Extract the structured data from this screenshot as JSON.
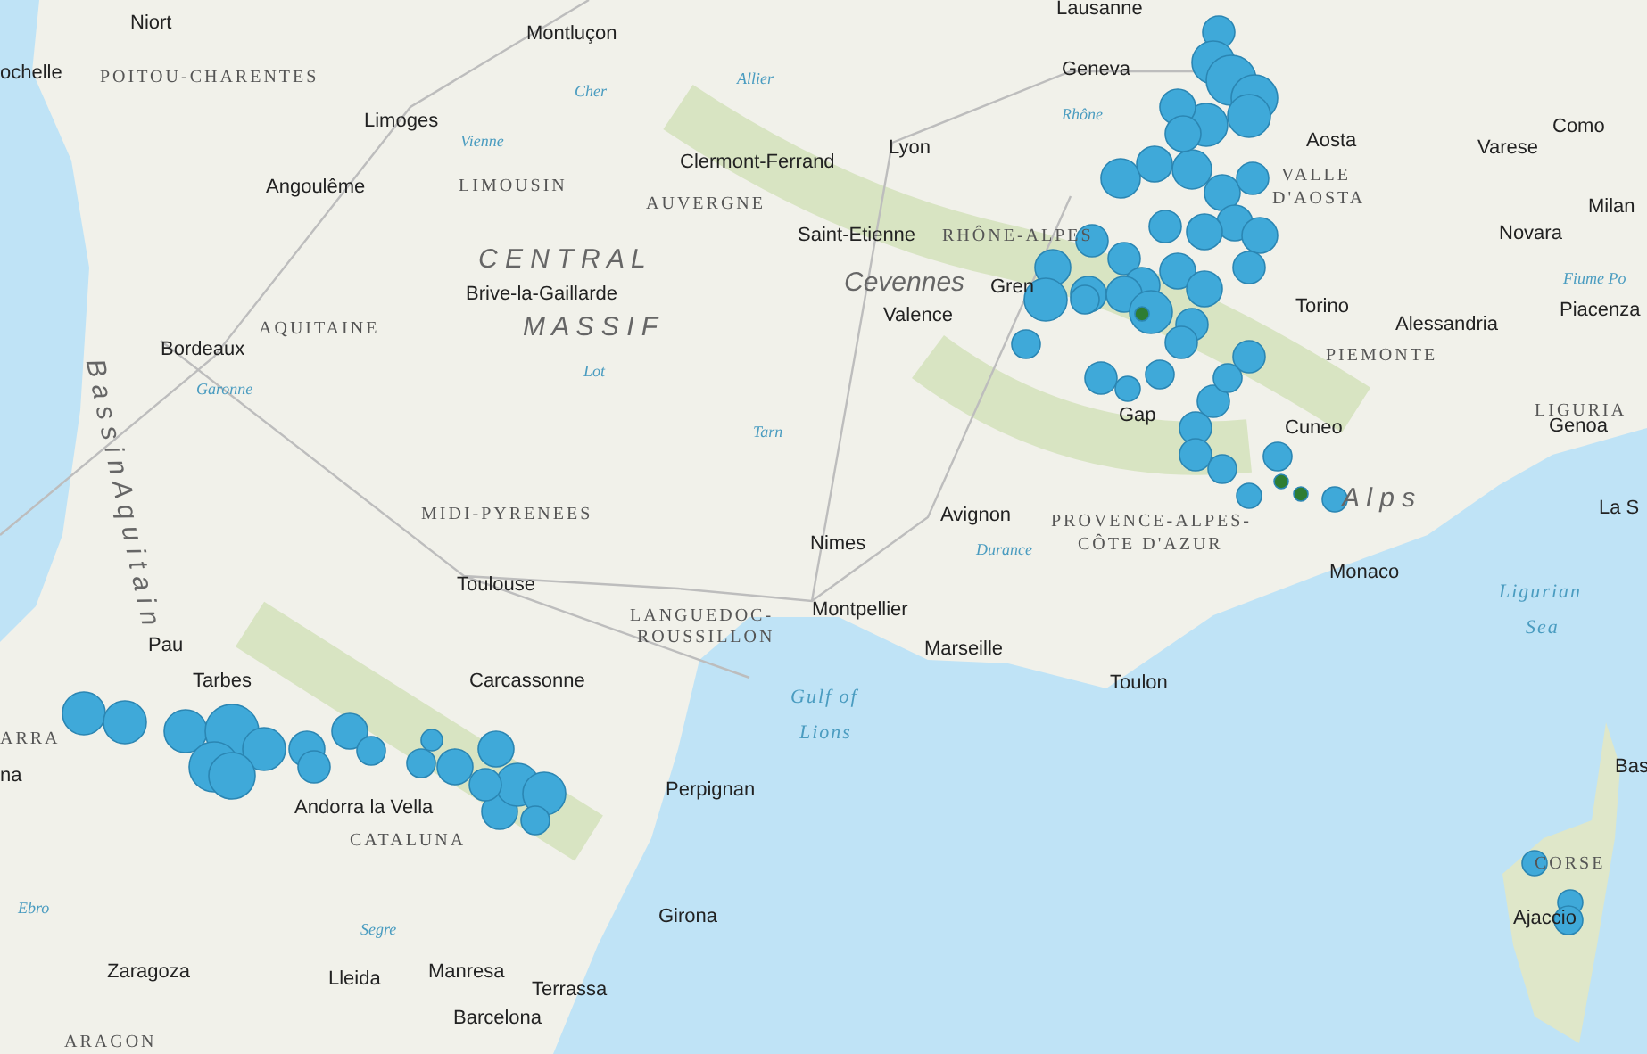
{
  "map": {
    "labels": [
      {
        "text": "Niort",
        "kind": "city"
      },
      {
        "text": "Montluçon",
        "kind": "city"
      },
      {
        "text": "ochelle",
        "kind": "city"
      },
      {
        "text": "POITOU-CHARENTES",
        "kind": "region"
      },
      {
        "text": "Limoges",
        "kind": "city"
      },
      {
        "text": "Vienne",
        "kind": "water"
      },
      {
        "text": "Cher",
        "kind": "water"
      },
      {
        "text": "Allier",
        "kind": "water"
      },
      {
        "text": "Clermont-Ferrand",
        "kind": "city"
      },
      {
        "text": "Angoulême",
        "kind": "city"
      },
      {
        "text": "LIMOUSIN",
        "kind": "region"
      },
      {
        "text": "AUVERGNE",
        "kind": "region"
      },
      {
        "text": "Lausanne",
        "kind": "city"
      },
      {
        "text": "Geneva",
        "kind": "city"
      },
      {
        "text": "Lyon",
        "kind": "city"
      },
      {
        "text": "Rhône",
        "kind": "water"
      },
      {
        "text": "Aosta",
        "kind": "city"
      },
      {
        "text": "VALLE",
        "kind": "region"
      },
      {
        "text": "D'AOSTA",
        "kind": "region"
      },
      {
        "text": "Como",
        "kind": "city"
      },
      {
        "text": "Varese",
        "kind": "city"
      },
      {
        "text": "Milan",
        "kind": "city"
      },
      {
        "text": "Saint-Etienne",
        "kind": "city"
      },
      {
        "text": "RHÔNE-ALPES",
        "kind": "region"
      },
      {
        "text": "Novara",
        "kind": "city"
      },
      {
        "text": "C E N T R A L",
        "kind": "mountain"
      },
      {
        "text": "Brive-la-Gaillarde",
        "kind": "city"
      },
      {
        "text": "Cevennes",
        "kind": "mountain"
      },
      {
        "text": "Gren",
        "kind": "city"
      },
      {
        "text": "Valence",
        "kind": "city"
      },
      {
        "text": "AQUITAINE",
        "kind": "region"
      },
      {
        "text": "M A S S I F",
        "kind": "mountain"
      },
      {
        "text": "Bordeaux",
        "kind": "city"
      },
      {
        "text": "Garonne",
        "kind": "water"
      },
      {
        "text": "Fiume Po",
        "kind": "water"
      },
      {
        "text": "Torino",
        "kind": "city"
      },
      {
        "text": "Alessandria",
        "kind": "city"
      },
      {
        "text": "Piacenza",
        "kind": "city"
      },
      {
        "text": "PIEMONTE",
        "kind": "region"
      },
      {
        "text": "Lot",
        "kind": "water"
      },
      {
        "text": "Tarn",
        "kind": "water"
      },
      {
        "text": "Gap",
        "kind": "city"
      },
      {
        "text": "Cuneo",
        "kind": "city"
      },
      {
        "text": "LIGURIA",
        "kind": "region"
      },
      {
        "text": "Genoa",
        "kind": "city"
      },
      {
        "text": "A l p s",
        "kind": "mountain"
      },
      {
        "text": "La S",
        "kind": "city"
      },
      {
        "text": "MIDI-PYRENEES",
        "kind": "region"
      },
      {
        "text": "Avignon",
        "kind": "city"
      },
      {
        "text": "PROVENCE-ALPES-",
        "kind": "region"
      },
      {
        "text": "Nimes",
        "kind": "city"
      },
      {
        "text": "Durance",
        "kind": "water"
      },
      {
        "text": "CÔTE D'AZUR",
        "kind": "region"
      },
      {
        "text": "Toulouse",
        "kind": "city"
      },
      {
        "text": "Monaco",
        "kind": "city"
      },
      {
        "text": "LANGUEDOC-",
        "kind": "region"
      },
      {
        "text": "Montpellier",
        "kind": "city"
      },
      {
        "text": "Ligurian",
        "kind": "sea"
      },
      {
        "text": "ROUSSILLON",
        "kind": "region"
      },
      {
        "text": "Sea",
        "kind": "sea"
      },
      {
        "text": "Pau",
        "kind": "city"
      },
      {
        "text": "Marseille",
        "kind": "city"
      },
      {
        "text": "Tarbes",
        "kind": "city"
      },
      {
        "text": "Carcassonne",
        "kind": "city"
      },
      {
        "text": "Toulon",
        "kind": "city"
      },
      {
        "text": "Gulf of",
        "kind": "sea"
      },
      {
        "text": "Lions",
        "kind": "sea"
      },
      {
        "text": "B a s s i n   A q u i t a i n",
        "kind": "mountain"
      },
      {
        "text": "ARRA",
        "kind": "region"
      },
      {
        "text": "na",
        "kind": "city"
      },
      {
        "text": "Bas",
        "kind": "city"
      },
      {
        "text": "Andorra la Vella",
        "kind": "city"
      },
      {
        "text": "Perpignan",
        "kind": "city"
      },
      {
        "text": "CATALUNA",
        "kind": "region"
      },
      {
        "text": "CORSE",
        "kind": "region"
      },
      {
        "text": "Ebro",
        "kind": "water"
      },
      {
        "text": "Segre",
        "kind": "water"
      },
      {
        "text": "Girona",
        "kind": "city"
      },
      {
        "text": "Ajaccio",
        "kind": "city"
      },
      {
        "text": "Zaragoza",
        "kind": "city"
      },
      {
        "text": "Lleida",
        "kind": "city"
      },
      {
        "text": "Manresa",
        "kind": "city"
      },
      {
        "text": "Terrassa",
        "kind": "city"
      },
      {
        "text": "Barcelona",
        "kind": "city"
      },
      {
        "text": "ARAGON",
        "kind": "region"
      }
    ],
    "markers": [
      {
        "color": "#3fa9d9"
      },
      {
        "color": "#3fa9d9"
      },
      {
        "color": "#3fa9d9"
      },
      {
        "color": "#3fa9d9"
      },
      {
        "color": "#3fa9d9"
      },
      {
        "color": "#3fa9d9"
      },
      {
        "color": "#3fa9d9"
      },
      {
        "color": "#3fa9d9"
      },
      {
        "color": "#3fa9d9"
      },
      {
        "color": "#3fa9d9"
      },
      {
        "color": "#3fa9d9"
      },
      {
        "color": "#3fa9d9"
      },
      {
        "color": "#3fa9d9"
      },
      {
        "color": "#3fa9d9"
      },
      {
        "color": "#3fa9d9"
      },
      {
        "color": "#3fa9d9"
      },
      {
        "color": "#3fa9d9"
      },
      {
        "color": "#3fa9d9"
      },
      {
        "color": "#3fa9d9"
      },
      {
        "color": "#3fa9d9"
      },
      {
        "color": "#3fa9d9"
      },
      {
        "color": "#3fa9d9"
      },
      {
        "color": "#3fa9d9"
      },
      {
        "color": "#3fa9d9"
      },
      {
        "color": "#3fa9d9"
      },
      {
        "color": "#3fa9d9"
      },
      {
        "color": "#3fa9d9"
      },
      {
        "color": "#3fa9d9"
      },
      {
        "color": "#3fa9d9"
      },
      {
        "color": "#3fa9d9"
      },
      {
        "color": "#3fa9d9"
      },
      {
        "color": "#3fa9d9"
      },
      {
        "color": "#3fa9d9"
      },
      {
        "color": "#3fa9d9"
      },
      {
        "color": "#3fa9d9"
      },
      {
        "color": "#3fa9d9"
      },
      {
        "color": "#3fa9d9"
      },
      {
        "color": "#3fa9d9"
      },
      {
        "color": "#3fa9d9"
      },
      {
        "color": "#3fa9d9"
      },
      {
        "color": "#3fa9d9"
      },
      {
        "color": "#3fa9d9"
      },
      {
        "color": "#3fa9d9"
      },
      {
        "color": "#3fa9d9"
      },
      {
        "color": "#2e7d32"
      },
      {
        "color": "#2e7d32"
      },
      {
        "color": "#2e7d32"
      },
      {
        "color": "#3fa9d9"
      },
      {
        "color": "#3fa9d9"
      },
      {
        "color": "#3fa9d9"
      },
      {
        "color": "#3fa9d9"
      },
      {
        "color": "#3fa9d9"
      },
      {
        "color": "#3fa9d9"
      },
      {
        "color": "#3fa9d9"
      },
      {
        "color": "#3fa9d9"
      },
      {
        "color": "#3fa9d9"
      },
      {
        "color": "#3fa9d9"
      },
      {
        "color": "#3fa9d9"
      },
      {
        "color": "#3fa9d9"
      },
      {
        "color": "#3fa9d9"
      },
      {
        "color": "#3fa9d9"
      },
      {
        "color": "#3fa9d9"
      },
      {
        "color": "#3fa9d9"
      },
      {
        "color": "#3fa9d9"
      },
      {
        "color": "#3fa9d9"
      },
      {
        "color": "#3fa9d9"
      },
      {
        "color": "#3fa9d9"
      },
      {
        "color": "#3fa9d9"
      },
      {
        "color": "#3fa9d9"
      },
      {
        "color": "#3fa9d9"
      }
    ]
  }
}
